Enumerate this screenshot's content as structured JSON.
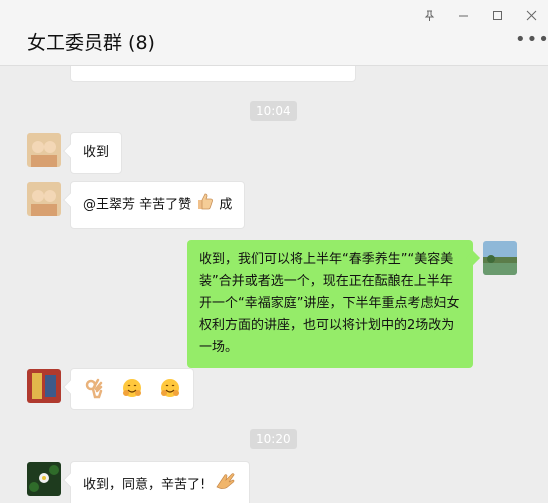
{
  "window": {
    "title": "女工委员群 (8)",
    "pin_icon": "pin-icon",
    "minimize_icon": "minimize-icon",
    "maximize_icon": "maximize-icon",
    "close_icon": "close-icon",
    "more_icon": "more-icon",
    "more_glyph": "•••"
  },
  "chat": {
    "time_1": "10:04",
    "msg_1": "收到",
    "msg_2_prefix": "@王翠芳 辛苦了赞",
    "msg_2_suffix": "成",
    "msg_3": "收到，我们可以将上半年“春季养生”“美容美装”合并或者选一个，现在正在酝酿在上半年开一个“幸福家庭”讲座，下半年重点考虑妇女权利方面的讲座，也可以将计划中的2场改为一场。",
    "time_2": "10:20",
    "msg_5": "收到，同意，辛苦了!"
  },
  "colors": {
    "my_bubble": "#95ec69",
    "other_bubble": "#ffffff",
    "chat_bg": "#ededed"
  }
}
